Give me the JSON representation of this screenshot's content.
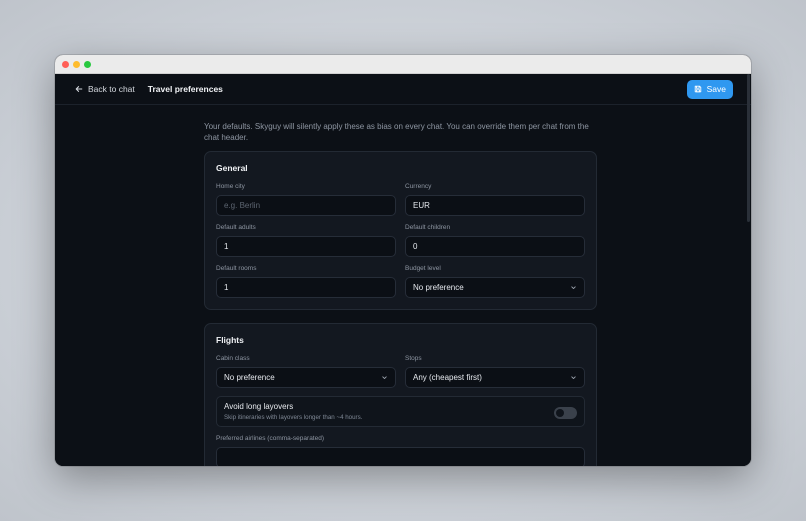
{
  "window": {
    "controls": {
      "close_color": "#ff5f57",
      "minimize_color": "#febc2e",
      "zoom_color": "#28c840"
    }
  },
  "header": {
    "back_label": "Back to chat",
    "title": "Travel preferences",
    "save_label": "Save",
    "accent_color": "#2f98f0"
  },
  "intro": "Your defaults. Skyguy will silently apply these as bias on every chat. You can override them per chat from the chat header.",
  "general": {
    "title": "General",
    "home_city": {
      "label": "Home city",
      "value": "",
      "placeholder": "e.g. Berlin"
    },
    "currency": {
      "label": "Currency",
      "value": "EUR"
    },
    "default_adults": {
      "label": "Default adults",
      "value": "1"
    },
    "default_children": {
      "label": "Default children",
      "value": "0"
    },
    "default_rooms": {
      "label": "Default rooms",
      "value": "1"
    },
    "budget_level": {
      "label": "Budget level",
      "value": "No preference"
    }
  },
  "flights": {
    "title": "Flights",
    "cabin_class": {
      "label": "Cabin class",
      "value": "No preference"
    },
    "stops": {
      "label": "Stops",
      "value": "Any (cheapest first)"
    },
    "avoid_layovers": {
      "title": "Avoid long layovers",
      "subtitle": "Skip itineraries with layovers longer than ~4 hours.",
      "enabled": false
    },
    "preferred_airlines": {
      "label": "Preferred airlines (comma-separated)"
    }
  }
}
